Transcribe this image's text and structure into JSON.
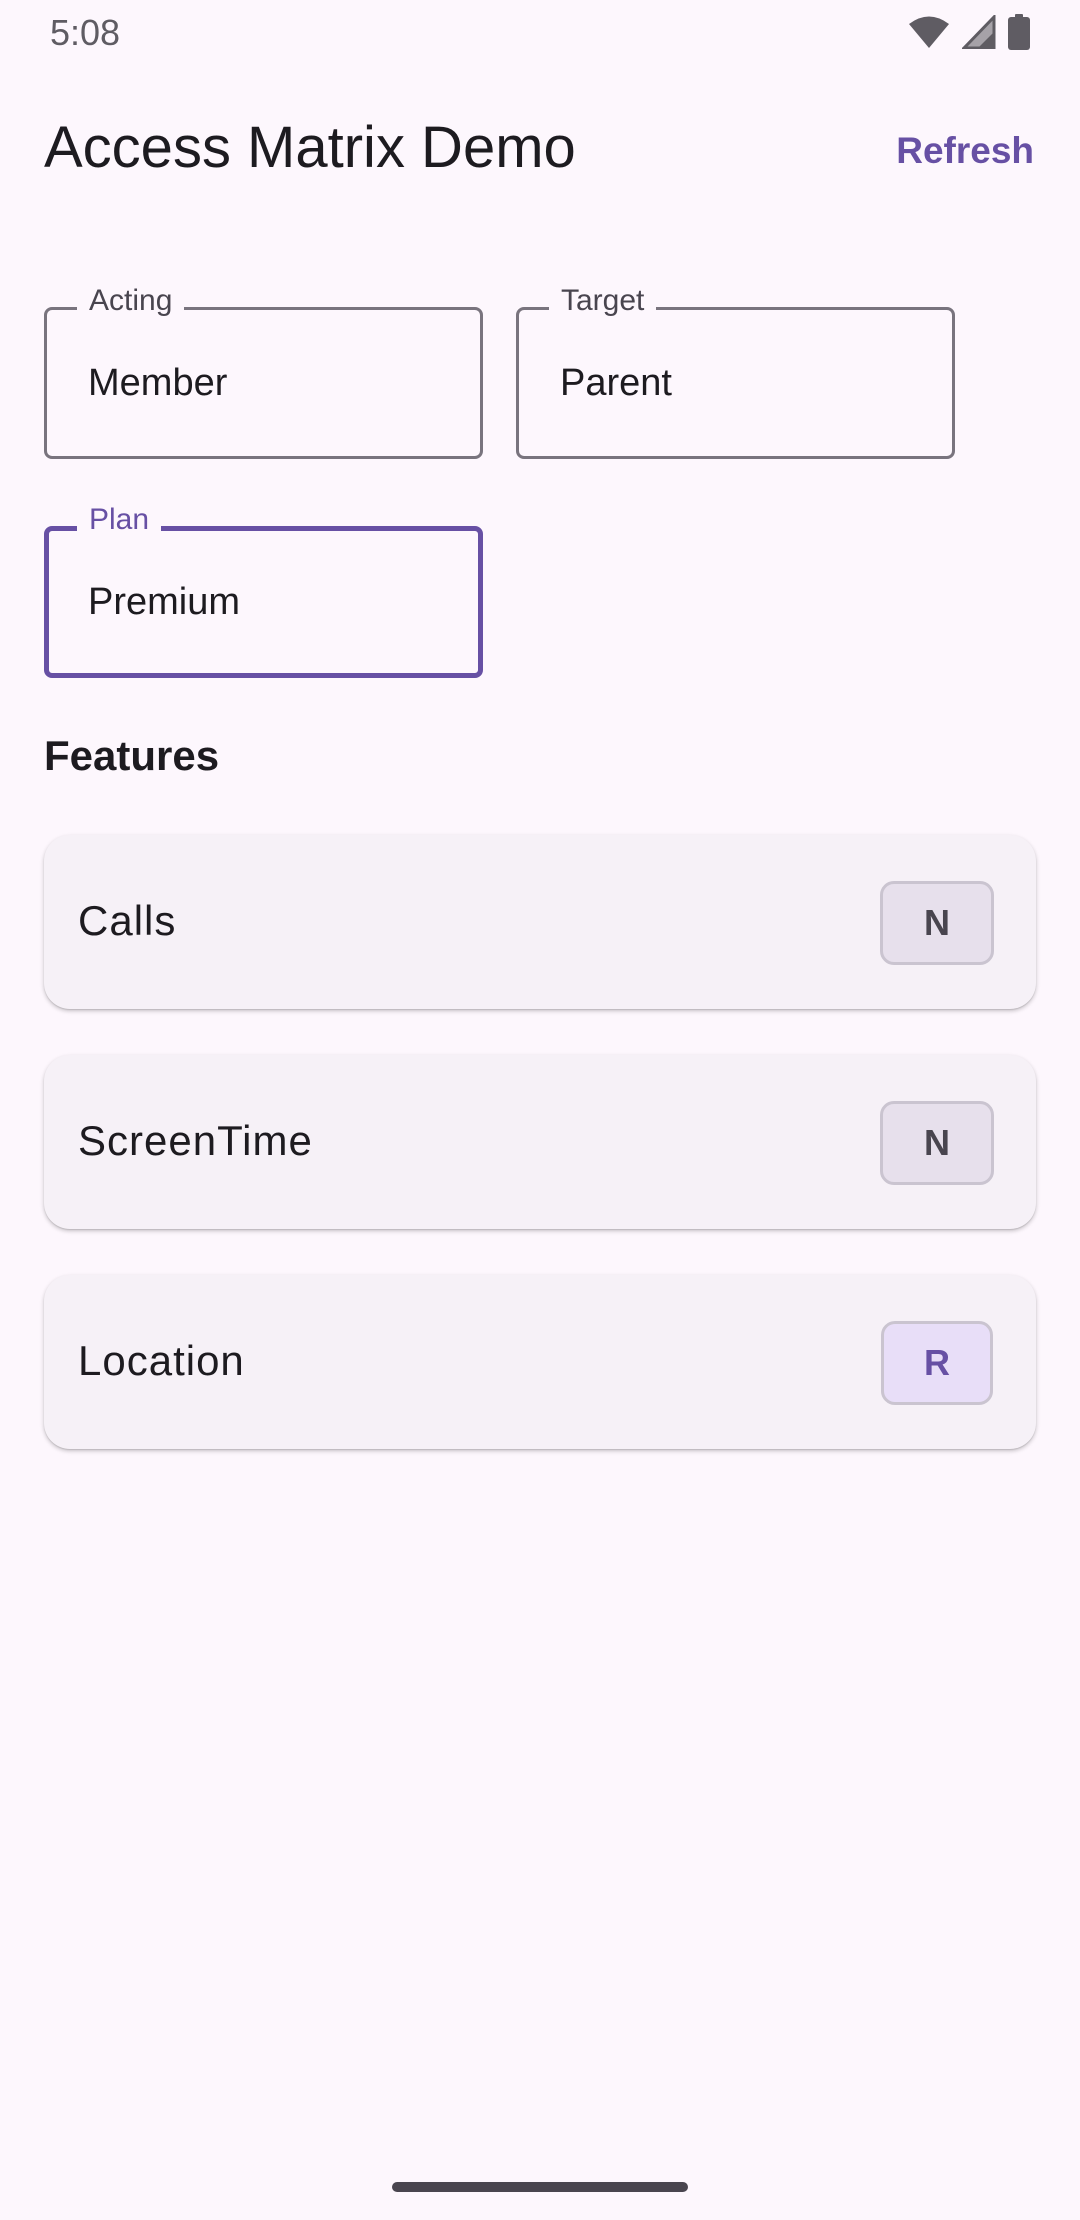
{
  "status_bar": {
    "time": "5:08",
    "icons": [
      "wifi-icon",
      "signal-icon",
      "battery-icon"
    ]
  },
  "app_bar": {
    "title": "Access Matrix Demo",
    "refresh_label": "Refresh"
  },
  "fields": {
    "acting": {
      "label": "Acting",
      "value": "Member"
    },
    "target": {
      "label": "Target",
      "value": "Parent"
    },
    "plan": {
      "label": "Plan",
      "value": "Premium"
    }
  },
  "features": {
    "title": "Features",
    "items": [
      {
        "name": "Calls",
        "access": "N"
      },
      {
        "name": "ScreenTime",
        "access": "N"
      },
      {
        "name": "Location",
        "access": "R"
      }
    ]
  },
  "colors": {
    "background": "#fdf7fd",
    "accent": "#6750a4",
    "card": "#f6f1f7",
    "badge_neutral": "#e7e0ec",
    "badge_granted": "#e8def8"
  }
}
